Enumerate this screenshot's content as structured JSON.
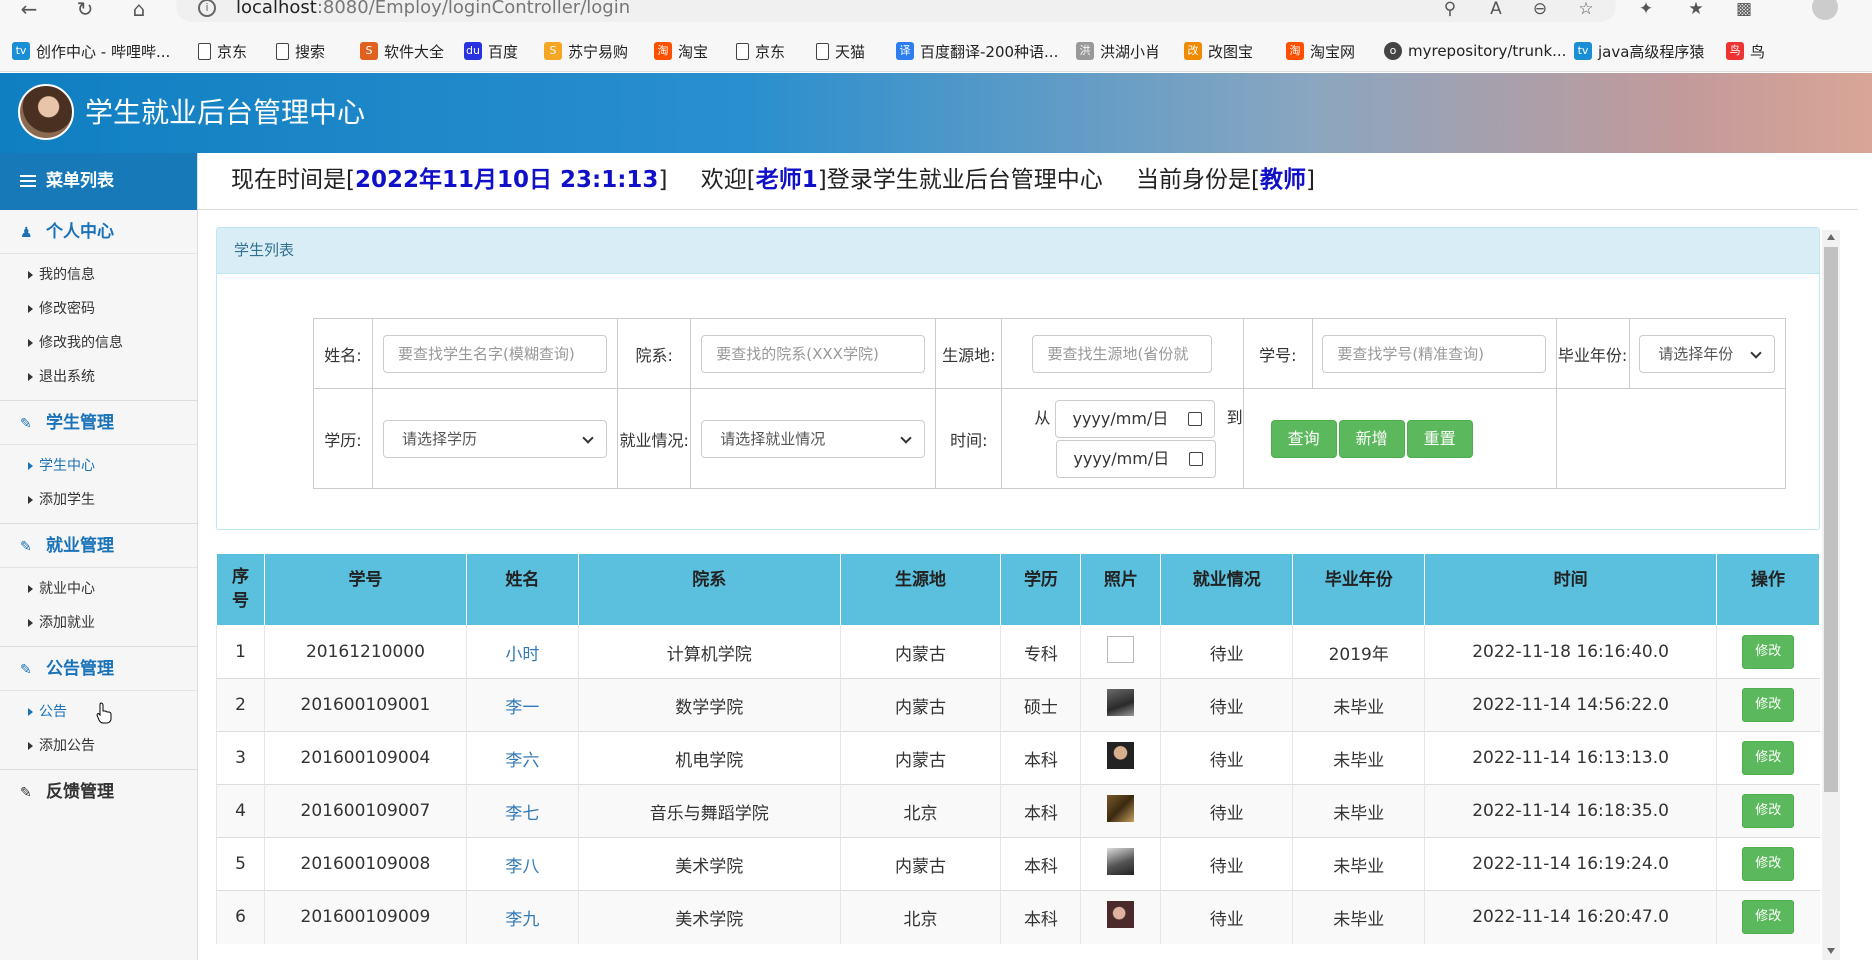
{
  "browser": {
    "url_host": "localhost",
    "url_rest": ":8080/Employ/loginController/login",
    "bookmarks": [
      "创作中心 - 哔哩哔...",
      "京东",
      "搜索",
      "软件大全",
      "百度",
      "苏宁易购",
      "淘宝",
      "京东",
      "天猫",
      "百度翻译-200种语...",
      "洪湖小肖",
      "改图宝",
      "淘宝网",
      "myrepository/trunk...",
      "java高级程序猿",
      "鸟"
    ]
  },
  "app": {
    "title": "学生就业后台管理中心"
  },
  "status": {
    "time_prefix": "现在时间是[",
    "time_value": "2022年11月10日 23:1:13",
    "time_suffix": "]",
    "welcome_prefix": "欢迎[",
    "user": "老师1",
    "welcome_suffix": "]登录学生就业后台管理中心",
    "role_prefix": "当前身份是[",
    "role": "教师",
    "role_suffix": "]"
  },
  "sidebar": {
    "menu_title": "菜单列表",
    "groups": [
      {
        "title": "个人中心",
        "items": [
          "我的信息",
          "修改密码",
          "修改我的信息",
          "退出系统"
        ]
      },
      {
        "title": "学生管理",
        "items": [
          "学生中心",
          "添加学生"
        ]
      },
      {
        "title": "就业管理",
        "items": [
          "就业中心",
          "添加就业"
        ]
      },
      {
        "title": "公告管理",
        "items": [
          "公告",
          "添加公告"
        ]
      },
      {
        "title": "反馈管理",
        "items": []
      }
    ]
  },
  "panel": {
    "title": "学生列表"
  },
  "filter": {
    "name_label": "姓名:",
    "name_placeholder": "要查找学生名字(模糊查询)",
    "dept_label": "院系:",
    "dept_placeholder": "要查找的院系(XXX学院)",
    "origin_label": "生源地:",
    "origin_placeholder": "要查找生源地(省份就",
    "id_label": "学号:",
    "id_placeholder": "要查找学号(精准查询)",
    "grad_label": "毕业年份:",
    "grad_select": "请选择年份",
    "edu_label": "学历:",
    "edu_select": "请选择学历",
    "emp_label": "就业情况:",
    "emp_select": "请选择就业情况",
    "time_label": "时间:",
    "from_label": "从",
    "to_label": "到",
    "date_placeholder": "yyyy/mm/日",
    "btn_query": "查询",
    "btn_add": "新增",
    "btn_reset": "重置"
  },
  "table": {
    "headers": [
      "序号",
      "学号",
      "姓名",
      "院系",
      "生源地",
      "学历",
      "照片",
      "就业情况",
      "毕业年份",
      "时间",
      "操作"
    ],
    "rows": [
      {
        "no": "1",
        "id": "20161210000",
        "name": "小时",
        "dept": "计算机学院",
        "origin": "内蒙古",
        "edu": "专科",
        "emp": "待业",
        "grad": "2019年",
        "time": "2022-11-18 16:16:40.0",
        "action": "修改"
      },
      {
        "no": "2",
        "id": "201600109001",
        "name": "李一",
        "dept": "数学学院",
        "origin": "内蒙古",
        "edu": "硕士",
        "emp": "待业",
        "grad": "未毕业",
        "time": "2022-11-14 14:56:22.0",
        "action": "修改"
      },
      {
        "no": "3",
        "id": "201600109004",
        "name": "李六",
        "dept": "机电学院",
        "origin": "内蒙古",
        "edu": "本科",
        "emp": "待业",
        "grad": "未毕业",
        "time": "2022-11-14 16:13:13.0",
        "action": "修改"
      },
      {
        "no": "4",
        "id": "201600109007",
        "name": "李七",
        "dept": "音乐与舞蹈学院",
        "origin": "北京",
        "edu": "本科",
        "emp": "待业",
        "grad": "未毕业",
        "time": "2022-11-14 16:18:35.0",
        "action": "修改"
      },
      {
        "no": "5",
        "id": "201600109008",
        "name": "李八",
        "dept": "美术学院",
        "origin": "内蒙古",
        "edu": "本科",
        "emp": "待业",
        "grad": "未毕业",
        "time": "2022-11-14 16:19:24.0",
        "action": "修改"
      },
      {
        "no": "6",
        "id": "201600109009",
        "name": "李九",
        "dept": "美术学院",
        "origin": "北京",
        "edu": "本科",
        "emp": "待业",
        "grad": "未毕业",
        "time": "2022-11-14 16:20:47.0",
        "action": "修改"
      }
    ]
  },
  "colors": {
    "header_blue": "#1879b9",
    "table_head": "#5bc0de",
    "btn_green": "#5cb85c",
    "link_blue": "#337ab7",
    "highlight": "#1010c8"
  }
}
